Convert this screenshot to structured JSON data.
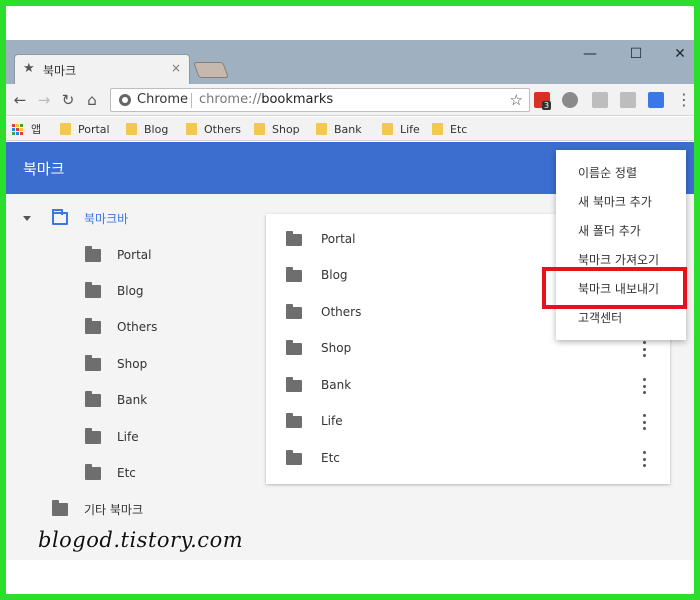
{
  "window": {
    "tab_title": "북마크",
    "tab_close": "×",
    "minimize": "—",
    "maximize": "☐",
    "close": "✕"
  },
  "toolbar": {
    "back": "←",
    "forward": "→",
    "reload": "↻",
    "home": "⌂",
    "scheme_label": "Chrome",
    "url_scheme": "chrome://",
    "url_host": "bookmarks",
    "extension_badge": "3"
  },
  "bookmarks_bar": {
    "apps_label": "앱",
    "items": [
      "Portal",
      "Blog",
      "Others",
      "Shop",
      "Bank",
      "Life",
      "Etc"
    ]
  },
  "header": {
    "title": "북마크"
  },
  "tree": {
    "root": "북마크바",
    "children": [
      "Portal",
      "Blog",
      "Others",
      "Shop",
      "Bank",
      "Life",
      "Etc"
    ],
    "other": "기타 북마크"
  },
  "list": {
    "items": [
      "Portal",
      "Blog",
      "Others",
      "Shop",
      "Bank",
      "Life",
      "Etc"
    ]
  },
  "menu": {
    "items": [
      "이름순 정렬",
      "새 북마크 추가",
      "새 폴더 추가",
      "북마크 가져오기",
      "북마크 내보내기",
      "고객센터"
    ]
  },
  "watermark": "blogod.tistory.com",
  "colors": {
    "frame": "#2bde2b",
    "header": "#3b6ecf",
    "active_folder": "#3b78e7",
    "highlight": "#e8101c"
  }
}
